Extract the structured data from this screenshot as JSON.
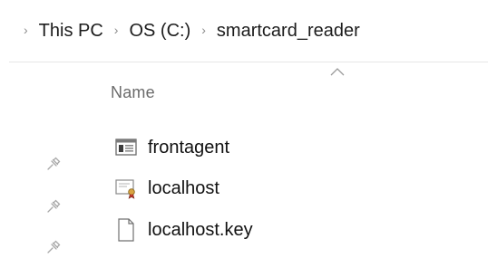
{
  "breadcrumb": {
    "items": [
      {
        "label": "This PC"
      },
      {
        "label": "OS (C:)"
      },
      {
        "label": "smartcard_reader"
      }
    ],
    "separator": "›"
  },
  "columns": {
    "name_label": "Name",
    "sort_direction": "ascending"
  },
  "files": [
    {
      "name": "frontagent",
      "icon": "application-window-icon"
    },
    {
      "name": "localhost",
      "icon": "certificate-icon"
    },
    {
      "name": "localhost.key",
      "icon": "blank-file-icon"
    }
  ],
  "pins": {
    "icon": "pin-icon",
    "count": 3
  },
  "colors": {
    "text": "#111111",
    "muted_text": "#6b6b6b",
    "separator": "#8a8a8a",
    "divider": "#e6e6e6"
  }
}
